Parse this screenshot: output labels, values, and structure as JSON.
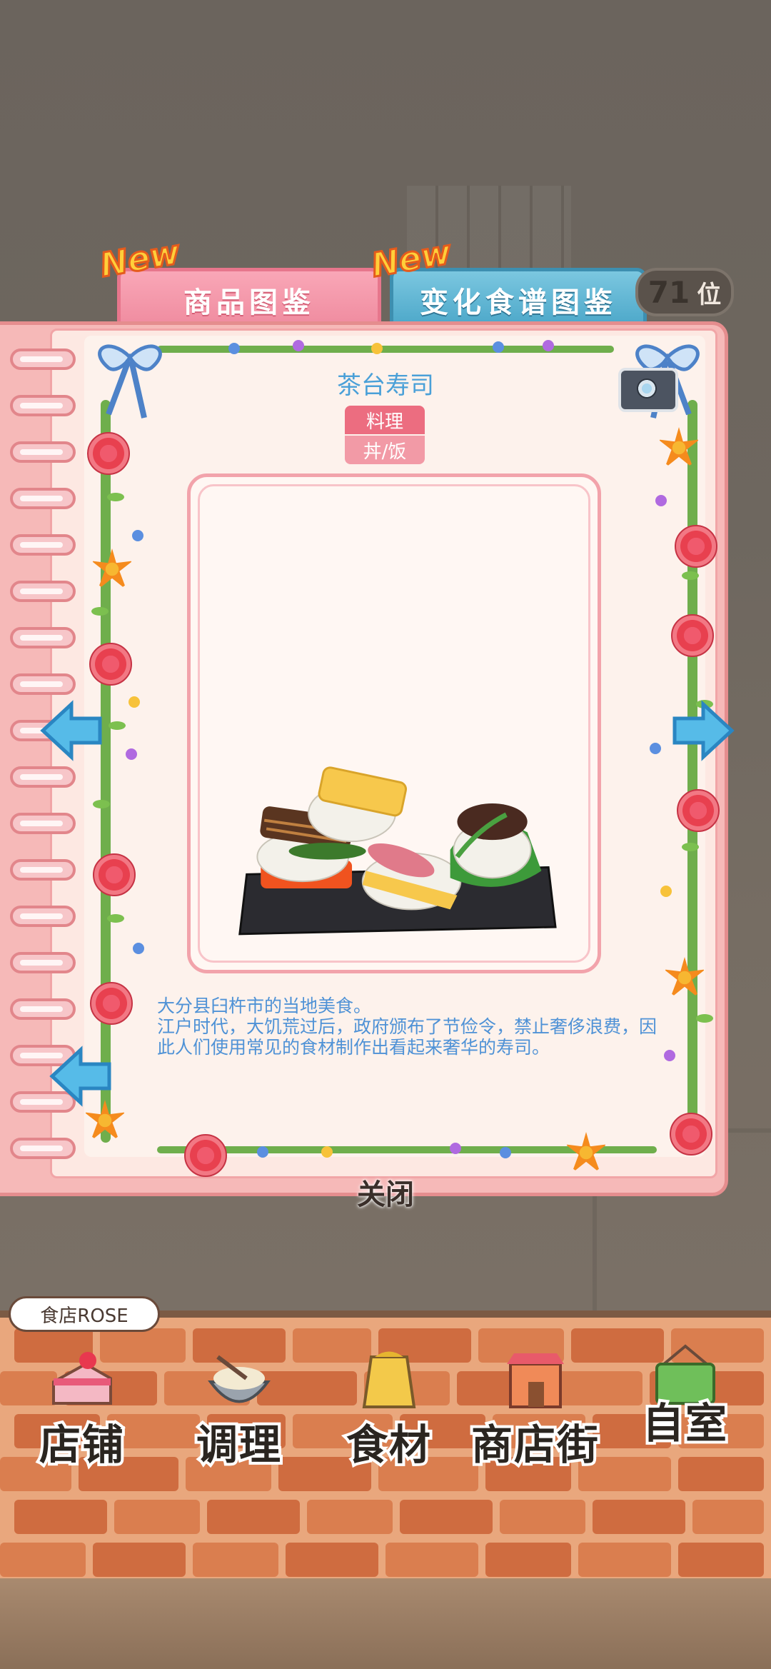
{
  "tabs": {
    "goods": {
      "label": "商品图鉴",
      "badge": "New"
    },
    "recipe": {
      "label": "变化食谱图鉴",
      "badge": "New"
    }
  },
  "rank": {
    "number": "71",
    "unit": "位"
  },
  "item": {
    "name": "茶台寿司",
    "category": "料理",
    "subcategory": "丼/饭",
    "description": [
      "大分县臼杵市的当地美食。",
      "江户时代，大饥荒过后，政府颁布了节俭令，禁止奢侈浪费，因此人们使用常见的食材制作出看起来奢华的寿司。"
    ]
  },
  "close_label": "关闭",
  "shop": {
    "name": "食店ROSE"
  },
  "nav": [
    {
      "label": "店铺",
      "icon": "cake-icon"
    },
    {
      "label": "调理",
      "icon": "mixing-bowl-icon"
    },
    {
      "label": "食材",
      "icon": "ingredient-bag-icon"
    },
    {
      "label": "商店街",
      "icon": "shop-building-icon"
    },
    {
      "label": "自室",
      "icon": "staff-only-sign-icon"
    }
  ],
  "colors": {
    "book_pink": "#f6b9b8",
    "title_blue": "#4aa0d8",
    "tag_red": "#ec6d80",
    "brick": "#cf6c40"
  }
}
